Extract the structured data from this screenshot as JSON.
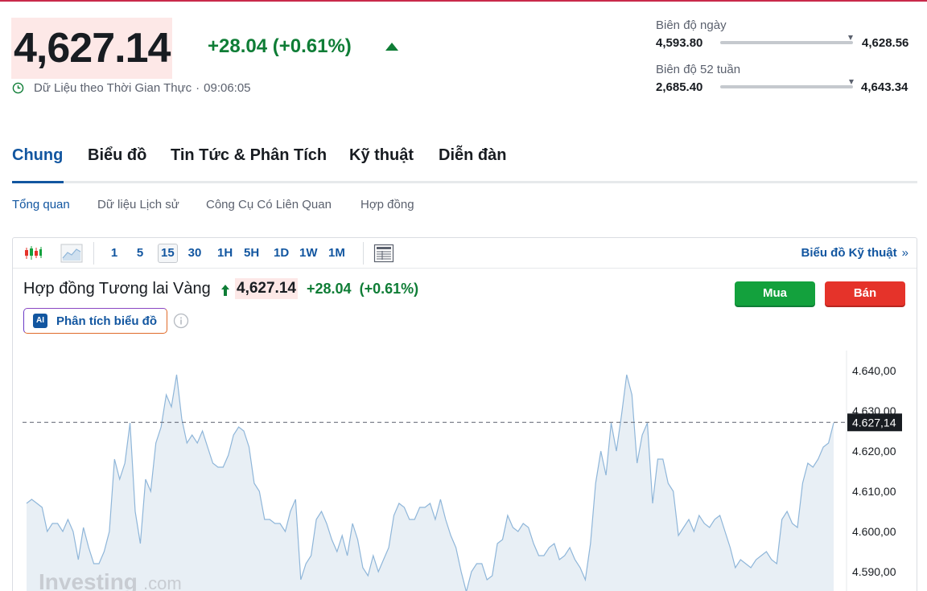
{
  "quote": {
    "price": "4,627.14",
    "change": "+28.04 (+0.61%)",
    "realtime_label": "Dữ Liệu theo Thời Gian Thực",
    "separator": "·",
    "time": "09:06:05"
  },
  "ranges": {
    "day": {
      "label": "Biên độ ngày",
      "low": "4,593.80",
      "high": "4,628.56",
      "marker_fraction": 0.98
    },
    "year": {
      "label": "Biên độ 52 tuần",
      "low": "2,685.40",
      "high": "4,643.34",
      "marker_fraction": 0.99
    }
  },
  "tabs": [
    {
      "label": "Chung",
      "active": true
    },
    {
      "label": "Biểu đồ",
      "active": false
    },
    {
      "label": "Tin Tức & Phân Tích",
      "active": false
    },
    {
      "label": "Kỹ thuật",
      "active": false
    },
    {
      "label": "Diễn đàn",
      "active": false
    }
  ],
  "subtabs": [
    {
      "label": "Tổng quan",
      "active": true
    },
    {
      "label": "Dữ liệu Lịch sử",
      "active": false
    },
    {
      "label": "Công Cụ Có Liên Quan",
      "active": false
    },
    {
      "label": "Hợp đồng",
      "active": false
    }
  ],
  "toolbar": {
    "chart_type_icons": [
      "candlestick-icon",
      "area-chart-icon"
    ],
    "timeframes": [
      {
        "label": "1",
        "active": false
      },
      {
        "label": "5",
        "active": false
      },
      {
        "label": "15",
        "active": true
      },
      {
        "label": "30",
        "active": false
      },
      {
        "label": "1H",
        "active": false
      },
      {
        "label": "5H",
        "active": false
      },
      {
        "label": "1D",
        "active": false
      },
      {
        "label": "1W",
        "active": false
      },
      {
        "label": "1M",
        "active": false
      }
    ],
    "layout_icon": "table-layout-icon",
    "tech_chart_link": "Biểu đồ Kỹ thuật",
    "tech_chart_chevron": "»"
  },
  "chart_header": {
    "title": "Hợp đồng Tương lai Vàng",
    "price": "4,627.14",
    "change": "+28.04",
    "change_pct": "(+0.61%)",
    "buy_label": "Mua",
    "sell_label": "Bán",
    "ai_badge": "AI",
    "ai_label": "Phân tích biểu đồ"
  },
  "watermark": {
    "brand": "Investing",
    "suffix": ".com"
  },
  "colors": {
    "accent": "#1256a0",
    "up": "#0f7d36",
    "buy": "#13a13d",
    "sell": "#e5332a",
    "price_highlight": "#fde8e7",
    "line": "#8fb6d9",
    "area": "#e8eff5"
  },
  "chart_data": {
    "type": "area",
    "title": "",
    "xlabel": "",
    "ylabel": "",
    "ylim": [
      4586,
      4645
    ],
    "y_ticks": [
      "4.640,00",
      "4.630,00",
      "4.620,00",
      "4.610,00",
      "4.600,00",
      "4.590,00"
    ],
    "y_tick_values": [
      4640,
      4630,
      4620,
      4610,
      4600,
      4590
    ],
    "last_value": 4627.14,
    "last_value_label": "4.627,14",
    "grid": false,
    "values": [
      4607,
      4608,
      4607,
      4606,
      4600,
      4602,
      4602,
      4600,
      4603,
      4600,
      4593,
      4601,
      4596,
      4592,
      4592,
      4595,
      4600,
      4618,
      4613,
      4617,
      4627,
      4605,
      4597,
      4613,
      4610,
      4622,
      4626,
      4634,
      4631,
      4639,
      4628,
      4622,
      4624,
      4622,
      4625,
      4621,
      4617,
      4616,
      4616,
      4619,
      4624,
      4626,
      4625,
      4621,
      4612,
      4610,
      4603,
      4603,
      4602,
      4602,
      4600,
      4605,
      4608,
      4588,
      4592,
      4594,
      4603,
      4605,
      4602,
      4598,
      4595,
      4599,
      4594,
      4602,
      4598,
      4591,
      4589,
      4594,
      4590,
      4593,
      4596,
      4604,
      4607,
      4606,
      4603,
      4603,
      4606,
      4606,
      4607,
      4603,
      4608,
      4603,
      4599,
      4596,
      4590,
      4585,
      4590,
      4592,
      4592,
      4588,
      4589,
      4597,
      4598,
      4604,
      4601,
      4600,
      4602,
      4601,
      4597,
      4594,
      4594,
      4596,
      4597,
      4593,
      4594,
      4596,
      4593,
      4591,
      4588,
      4597,
      4612,
      4620,
      4614,
      4627,
      4620,
      4629,
      4639,
      4634,
      4617,
      4624,
      4627,
      4607,
      4618,
      4618,
      4612,
      4610,
      4599,
      4601,
      4603,
      4600,
      4604,
      4602,
      4601,
      4603,
      4604,
      4600,
      4596,
      4591,
      4593,
      4592,
      4591,
      4593,
      4594,
      4595,
      4593,
      4592,
      4603,
      4605,
      4602,
      4601,
      4612,
      4617,
      4616,
      4618,
      4621,
      4622,
      4627
    ]
  }
}
